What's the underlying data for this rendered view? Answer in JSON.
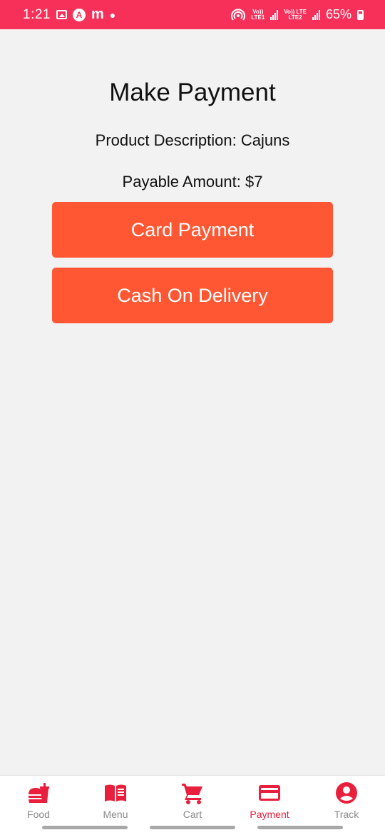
{
  "status_bar": {
    "time": "1:21",
    "app_icons": [
      "gallery-icon",
      "a-circle-icon",
      "m-icon"
    ],
    "network1_top": "Vo))",
    "network1_bottom": "LTE1",
    "network2_top": "Vo)) LTE",
    "network2_bottom": "LTE2",
    "battery": "65%"
  },
  "page": {
    "title": "Make Payment",
    "description": "Product Description: Cajuns",
    "amount": "Payable Amount: $7"
  },
  "buttons": {
    "card": "Card Payment",
    "cash": "Cash On Delivery"
  },
  "nav": {
    "items": [
      {
        "label": "Food",
        "icon": "fastfood-icon"
      },
      {
        "label": "Menu",
        "icon": "menu-book-icon"
      },
      {
        "label": "Cart",
        "icon": "cart-icon"
      },
      {
        "label": "Payment",
        "icon": "credit-card-icon",
        "active": true
      },
      {
        "label": "Track",
        "icon": "account-circle-icon"
      }
    ]
  },
  "colors": {
    "status_bar": "#f7305a",
    "button": "#ff5733",
    "nav_icon": "#e8203e",
    "background": "#f2f2f2"
  }
}
